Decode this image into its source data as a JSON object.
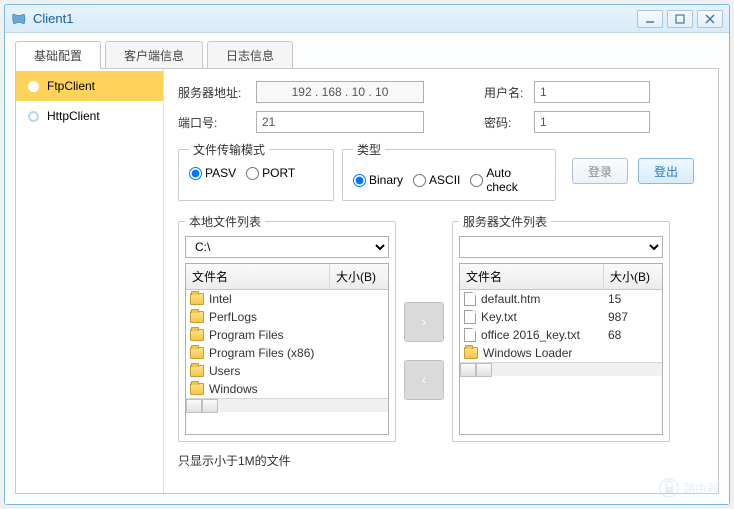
{
  "window": {
    "title": "Client1"
  },
  "tabs": [
    {
      "label": "基础配置",
      "active": true
    },
    {
      "label": "客户端信息",
      "active": false
    },
    {
      "label": "日志信息",
      "active": false
    }
  ],
  "sidebar": {
    "items": [
      {
        "label": "FtpClient",
        "active": true
      },
      {
        "label": "HttpClient",
        "active": false
      }
    ]
  },
  "connection": {
    "server_label": "服务器地址:",
    "server_value": "192 . 168 .  10  .  10",
    "port_label": "端口号:",
    "port_value": "21",
    "user_label": "用户名:",
    "user_value": "1",
    "pass_label": "密码:",
    "pass_value": "1"
  },
  "transfer_mode": {
    "legend": "文件传输模式",
    "options": [
      "PASV",
      "PORT"
    ],
    "selected": "PASV"
  },
  "type_mode": {
    "legend": "类型",
    "options": [
      "Binary",
      "ASCII",
      "Auto check"
    ],
    "selected": "Binary"
  },
  "buttons": {
    "login": "登录",
    "logout": "登出"
  },
  "local_list": {
    "legend": "本地文件列表",
    "path": "C:\\",
    "col_name": "文件名",
    "col_size": "大小(B)",
    "rows": [
      {
        "name": "Intel",
        "type": "folder",
        "size": ""
      },
      {
        "name": "PerfLogs",
        "type": "folder",
        "size": ""
      },
      {
        "name": "Program Files",
        "type": "folder",
        "size": ""
      },
      {
        "name": "Program Files (x86)",
        "type": "folder",
        "size": ""
      },
      {
        "name": "Users",
        "type": "folder",
        "size": ""
      },
      {
        "name": "Windows",
        "type": "folder",
        "size": ""
      }
    ]
  },
  "server_list": {
    "legend": "服务器文件列表",
    "path": "",
    "col_name": "文件名",
    "col_size": "大小(B)",
    "rows": [
      {
        "name": "default.htm",
        "type": "file",
        "size": "15"
      },
      {
        "name": "Key.txt",
        "type": "file",
        "size": "987"
      },
      {
        "name": "office 2016_key.txt",
        "type": "file",
        "size": "68"
      },
      {
        "name": "Windows Loader",
        "type": "folder",
        "size": ""
      }
    ]
  },
  "note": "只显示小于1M的文件",
  "watermark": "路由器"
}
